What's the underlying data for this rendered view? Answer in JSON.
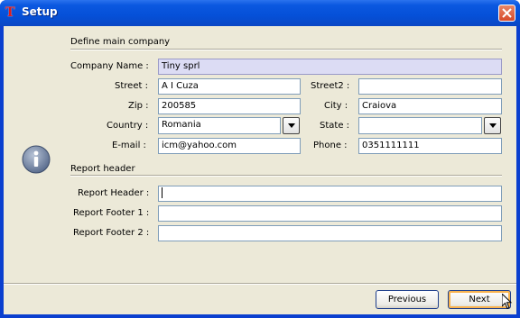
{
  "window": {
    "title": "Setup",
    "close_icon": "close-icon"
  },
  "company": {
    "section_label": "Define main company",
    "company_name_label": "Company Name :",
    "company_name_value": "Tiny sprl",
    "street_label": "Street :",
    "street_value": "A I Cuza",
    "street2_label": "Street2 :",
    "street2_value": "",
    "zip_label": "Zip :",
    "zip_value": "200585",
    "city_label": "City :",
    "city_value": "Craiova",
    "country_label": "Country :",
    "country_value": "Romania",
    "state_label": "State :",
    "state_value": "",
    "email_label": "E-mail :",
    "email_value": "icm@yahoo.com",
    "phone_label": "Phone :",
    "phone_value": "0351111111"
  },
  "report": {
    "section_label": "Report header",
    "header_label": "Report Header :",
    "header_value": "",
    "footer1_label": "Report Footer 1 :",
    "footer1_value": "",
    "footer2_label": "Report Footer 2 :",
    "footer2_value": ""
  },
  "buttons": {
    "previous": "Previous",
    "next": "Next"
  },
  "colors": {
    "title_bar": "#0550d8",
    "dialog_bg": "#ece9d8",
    "selected_field": "#dcdcf4",
    "input_border": "#7f9db9"
  }
}
